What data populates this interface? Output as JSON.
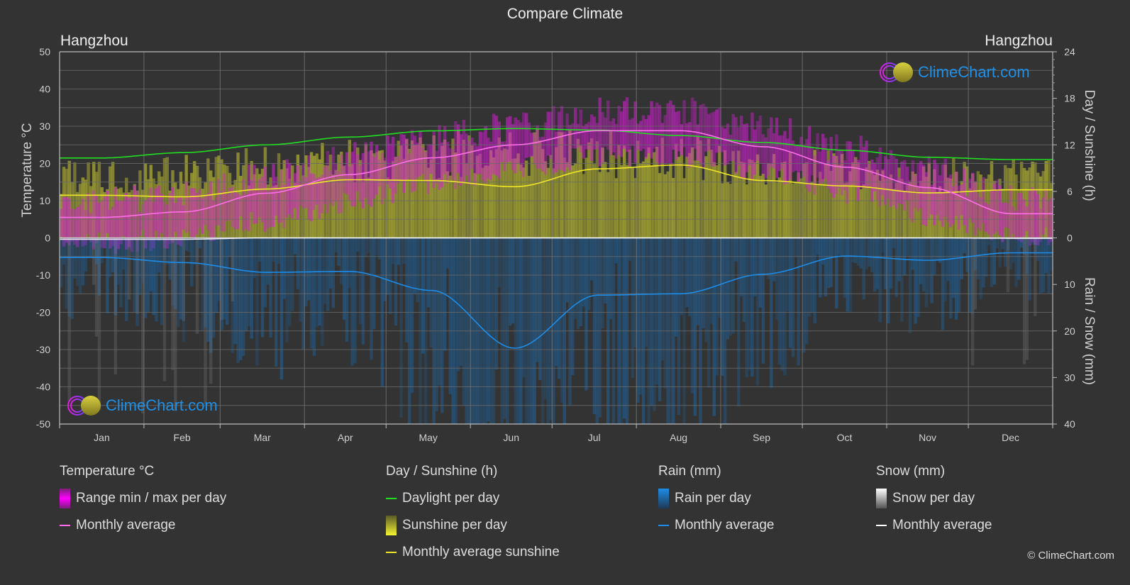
{
  "title": "Compare Climate",
  "city_left": "Hangzhou",
  "city_right": "Hangzhou",
  "logo_text": "ClimeChart.com",
  "copyright": "© ClimeChart.com",
  "colors": {
    "background": "#333333",
    "temp_avg": "#ff6ee8",
    "temp_range": "#d21ed2",
    "daylight": "#22dd22",
    "sunshine_avg": "#f0e628",
    "sunshine_bar": "#a8a832",
    "rain_avg": "#1e8ce6",
    "rain_bar": "#1e64a0",
    "snow_avg": "#ffffff",
    "snow_bar": "#888888",
    "grid": "#5a5a5a",
    "axis_text": "#d0d0d0",
    "logo": "#1e90e8"
  },
  "legend": {
    "temperature": {
      "heading": "Temperature °C",
      "range_label": "Range min / max per day",
      "avg_label": "Monthly average"
    },
    "sunshine": {
      "heading": "Day / Sunshine (h)",
      "daylight_label": "Daylight per day",
      "sunshine_label": "Sunshine per day",
      "avg_label": "Monthly average sunshine"
    },
    "rain": {
      "heading": "Rain (mm)",
      "rain_label": "Rain per day",
      "avg_label": "Monthly average"
    },
    "snow": {
      "heading": "Snow (mm)",
      "snow_label": "Snow per day",
      "avg_label": "Monthly average"
    }
  },
  "chart_data": {
    "type": "line",
    "title": "Compare Climate",
    "categories": [
      "Jan",
      "Feb",
      "Mar",
      "Apr",
      "May",
      "Jun",
      "Jul",
      "Aug",
      "Sep",
      "Oct",
      "Nov",
      "Dec"
    ],
    "axes": {
      "left": {
        "label": "Temperature °C",
        "range": [
          -50,
          50
        ],
        "ticks": [
          "50",
          "40",
          "30",
          "20",
          "10",
          "0",
          "-10",
          "-20",
          "-30",
          "-40",
          "-50"
        ]
      },
      "right_top": {
        "label": "Day / Sunshine (h)",
        "range": [
          0,
          24
        ],
        "ticks": [
          "24",
          "18",
          "12",
          "6",
          "0"
        ]
      },
      "right_bottom": {
        "label": "Rain / Snow (mm)",
        "range": [
          0,
          40
        ],
        "ticks": [
          "0",
          "10",
          "20",
          "30",
          "40"
        ]
      }
    },
    "grid": true,
    "legend_position": "bottom",
    "series": [
      {
        "name": "Temperature monthly average",
        "unit": "°C",
        "axis": "left",
        "values": [
          5.5,
          7.0,
          12.0,
          17.0,
          21.5,
          25.0,
          28.8,
          28.8,
          24.5,
          19.0,
          13.5,
          6.5
        ]
      },
      {
        "name": "Temperature daily max (approx)",
        "unit": "°C",
        "axis": "left",
        "values": [
          9.5,
          11.5,
          16.5,
          22.0,
          27.0,
          30.0,
          34.0,
          34.0,
          29.5,
          24.0,
          18.0,
          11.0
        ]
      },
      {
        "name": "Temperature daily min (approx)",
        "unit": "°C",
        "axis": "left",
        "values": [
          1.5,
          3.0,
          7.5,
          12.5,
          17.5,
          21.5,
          25.0,
          25.0,
          21.0,
          15.0,
          9.0,
          3.0
        ]
      },
      {
        "name": "Daylight per day",
        "unit": "h",
        "axis": "right_top",
        "values": [
          10.3,
          11.0,
          12.0,
          13.0,
          13.8,
          14.1,
          13.9,
          13.2,
          12.3,
          11.3,
          10.4,
          10.1
        ]
      },
      {
        "name": "Monthly average sunshine",
        "unit": "h",
        "axis": "right_top",
        "values": [
          5.5,
          5.3,
          6.3,
          7.5,
          7.4,
          6.6,
          8.9,
          9.4,
          7.4,
          6.7,
          5.8,
          6.2
        ]
      },
      {
        "name": "Rain monthly average",
        "unit": "mm",
        "axis": "right_bottom",
        "values": [
          4.2,
          5.3,
          7.4,
          7.2,
          11.3,
          23.7,
          12.3,
          12.0,
          7.8,
          3.9,
          4.8,
          3.2
        ]
      },
      {
        "name": "Snow monthly average",
        "unit": "mm",
        "axis": "right_bottom",
        "values": [
          0.3,
          0.3,
          0.0,
          0.0,
          0.0,
          0.0,
          0.0,
          0.0,
          0.0,
          0.0,
          0.0,
          0.1
        ]
      }
    ]
  }
}
